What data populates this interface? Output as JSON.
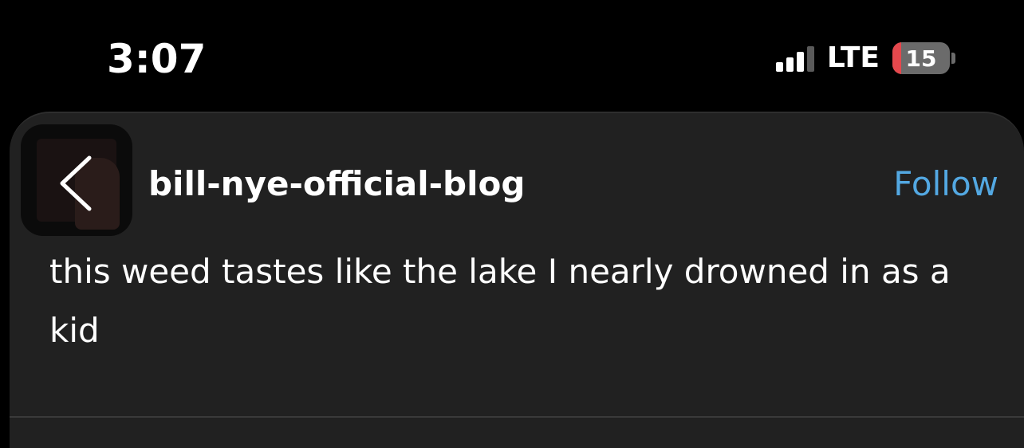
{
  "status_bar": {
    "time": "3:07",
    "network": "LTE",
    "battery_level": "15",
    "battery_fraction": 0.15,
    "signal_bars_active": 3,
    "signal_bars_total": 4
  },
  "post": {
    "blog_name": "bill-nye-official-blog",
    "follow_label": "Follow",
    "text": "this weed tastes like the lake I nearly drowned in as a kid"
  },
  "icons": {
    "back": "chevron-left-icon",
    "signal": "signal-icon",
    "battery": "battery-icon",
    "avatar": "avatar"
  },
  "colors": {
    "background": "#000000",
    "card": "#212121",
    "follow": "#53a8e2",
    "battery_low": "#e5484d"
  }
}
